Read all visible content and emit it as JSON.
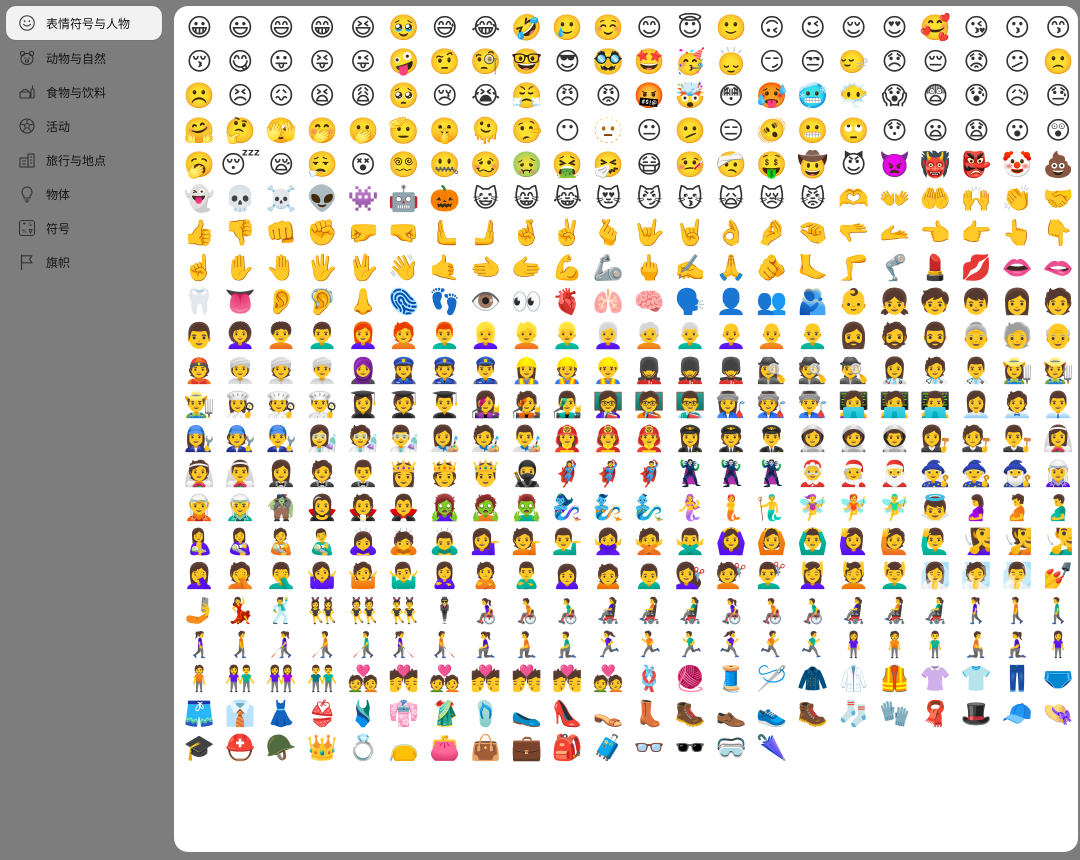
{
  "sidebar": {
    "items": [
      {
        "label": "表情符号与人物",
        "icon": "smiley-icon",
        "active": true
      },
      {
        "label": "动物与自然",
        "icon": "bear-icon",
        "active": false
      },
      {
        "label": "食物与饮料",
        "icon": "food-icon",
        "active": false
      },
      {
        "label": "活动",
        "icon": "ball-icon",
        "active": false
      },
      {
        "label": "旅行与地点",
        "icon": "building-icon",
        "active": false
      },
      {
        "label": "物体",
        "icon": "bulb-icon",
        "active": false
      },
      {
        "label": "符号",
        "icon": "symbols-icon",
        "active": false
      },
      {
        "label": "旗帜",
        "icon": "flag-icon",
        "active": false
      }
    ]
  },
  "emojis": [
    "😀",
    "😃",
    "😄",
    "😁",
    "😆",
    "🥹",
    "😅",
    "😂",
    "🤣",
    "🥲",
    "☺️",
    "😊",
    "😇",
    "🙂",
    "🙃",
    "😉",
    "😌",
    "😍",
    "🥰",
    "😘",
    "😗",
    "😙",
    "😚",
    "😋",
    "😛",
    "😝",
    "😜",
    "🤪",
    "🤨",
    "🧐",
    "🤓",
    "😎",
    "🥸",
    "🤩",
    "🥳",
    "🙂‍↕️",
    "😏",
    "😒",
    "🙂‍↔️",
    "😞",
    "😔",
    "😟",
    "😕",
    "🙁",
    "☹️",
    "😣",
    "😖",
    "😫",
    "😩",
    "🥺",
    "😢",
    "😭",
    "😤",
    "😠",
    "😡",
    "🤬",
    "🤯",
    "😳",
    "🥵",
    "🥶",
    "😶‍🌫️",
    "😱",
    "😨",
    "😰",
    "😥",
    "😓",
    "🤗",
    "🤔",
    "🫣",
    "🤭",
    "🫢",
    "🫡",
    "🤫",
    "🫠",
    "🤥",
    "😶",
    "🫥",
    "😐",
    "🫤",
    "😑",
    "🫨",
    "😬",
    "🙄",
    "😯",
    "😦",
    "😧",
    "😮",
    "😲",
    "🥱",
    "😴",
    "😪",
    "😮‍💨",
    "😵",
    "😵‍💫",
    "🤐",
    "🥴",
    "🤢",
    "🤮",
    "🤧",
    "😷",
    "🤒",
    "🤕",
    "🤑",
    "🤠",
    "😈",
    "👿",
    "👹",
    "👺",
    "🤡",
    "💩",
    "👻",
    "💀",
    "☠️",
    "👽",
    "👾",
    "🤖",
    "🎃",
    "😺",
    "😸",
    "😹",
    "😻",
    "😼",
    "😽",
    "🙀",
    "😿",
    "😾",
    "🫶",
    "👐",
    "🤲",
    "🙌",
    "👏",
    "🤝",
    "👍",
    "👎",
    "👊",
    "✊",
    "🤛",
    "🤜",
    "🫷",
    "🫸",
    "🤞",
    "✌️",
    "🫰",
    "🤟",
    "🤘",
    "👌",
    "🤌",
    "🤏",
    "🫳",
    "🫴",
    "👈",
    "👉",
    "👆",
    "👇",
    "☝️",
    "✋",
    "🤚",
    "🖐️",
    "🖖",
    "👋",
    "🤙",
    "🫲",
    "🫱",
    "💪",
    "🦾",
    "🖕",
    "✍️",
    "🙏",
    "🫵",
    "🦶",
    "🦵",
    "🦿",
    "💄",
    "💋",
    "👄",
    "🫦",
    "🦷",
    "👅",
    "👂",
    "🦻",
    "👃",
    "🫆",
    "👣",
    "👁️",
    "👀",
    "🫀",
    "🫁",
    "🧠",
    "🗣️",
    "👤",
    "👥",
    "🫂",
    "👶",
    "👧",
    "🧒",
    "👦",
    "👩",
    "🧑",
    "👨",
    "👩‍🦱",
    "🧑‍🦱",
    "👨‍🦱",
    "👩‍🦰",
    "🧑‍🦰",
    "👨‍🦰",
    "👱‍♀️",
    "👱",
    "👱‍♂️",
    "👩‍🦳",
    "🧑‍🦳",
    "👨‍🦳",
    "👩‍🦲",
    "🧑‍🦲",
    "👨‍🦲",
    "🧔‍♀️",
    "🧔",
    "🧔‍♂️",
    "👵",
    "🧓",
    "👴",
    "👲",
    "👳‍♀️",
    "👳",
    "👳‍♂️",
    "🧕",
    "👮‍♀️",
    "👮",
    "👮‍♂️",
    "👷‍♀️",
    "👷",
    "👷‍♂️",
    "💂‍♀️",
    "💂",
    "💂‍♂️",
    "🕵️‍♀️",
    "🕵️",
    "🕵️‍♂️",
    "👩‍⚕️",
    "🧑‍⚕️",
    "👨‍⚕️",
    "👩‍🌾",
    "🧑‍🌾",
    "👨‍🌾",
    "👩‍🍳",
    "🧑‍🍳",
    "👨‍🍳",
    "👩‍🎓",
    "🧑‍🎓",
    "👨‍🎓",
    "👩‍🎤",
    "🧑‍🎤",
    "👨‍🎤",
    "👩‍🏫",
    "🧑‍🏫",
    "👨‍🏫",
    "👩‍🏭",
    "🧑‍🏭",
    "👨‍🏭",
    "👩‍💻",
    "🧑‍💻",
    "👨‍💻",
    "👩‍💼",
    "🧑‍💼",
    "👨‍💼",
    "👩‍🔧",
    "🧑‍🔧",
    "👨‍🔧",
    "👩‍🔬",
    "🧑‍🔬",
    "👨‍🔬",
    "👩‍🎨",
    "🧑‍🎨",
    "👨‍🎨",
    "👩‍🚒",
    "🧑‍🚒",
    "👨‍🚒",
    "👩‍✈️",
    "🧑‍✈️",
    "👨‍✈️",
    "👩‍🚀",
    "🧑‍🚀",
    "👨‍🚀",
    "👩‍⚖️",
    "🧑‍⚖️",
    "👨‍⚖️",
    "👰‍♀️",
    "👰",
    "👰‍♂️",
    "🤵‍♀️",
    "🤵",
    "🤵‍♂️",
    "👸",
    "🫅",
    "🤴",
    "🥷",
    "🦸‍♀️",
    "🦸",
    "🦸‍♂️",
    "🦹‍♀️",
    "🦹",
    "🦹‍♂️",
    "🤶",
    "🧑‍🎄",
    "🎅",
    "🧙‍♀️",
    "🧙",
    "🧙‍♂️",
    "🧝‍♀️",
    "🧝",
    "🧝‍♂️",
    "🧌",
    "🧛‍♀️",
    "🧛",
    "🧛‍♂️",
    "🧟‍♀️",
    "🧟",
    "🧟‍♂️",
    "🧞‍♀️",
    "🧞",
    "🧞‍♂️",
    "🧜‍♀️",
    "🧜",
    "🧜‍♂️",
    "🧚‍♀️",
    "🧚",
    "🧚‍♂️",
    "👼",
    "🤰",
    "🫄",
    "🫃",
    "🤱",
    "👩‍🍼",
    "🧑‍🍼",
    "👨‍🍼",
    "🙇‍♀️",
    "🙇",
    "🙇‍♂️",
    "💁‍♀️",
    "💁",
    "💁‍♂️",
    "🙅‍♀️",
    "🙅",
    "🙅‍♂️",
    "🙆‍♀️",
    "🙆",
    "🙆‍♂️",
    "🙋‍♀️",
    "🙋",
    "🙋‍♂️",
    "🧏‍♀️",
    "🧏",
    "🧏‍♂️",
    "🤦‍♀️",
    "🤦",
    "🤦‍♂️",
    "🤷‍♀️",
    "🤷",
    "🤷‍♂️",
    "🙎‍♀️",
    "🙎",
    "🙎‍♂️",
    "🙍‍♀️",
    "🙍",
    "🙍‍♂️",
    "💇‍♀️",
    "💇",
    "💇‍♂️",
    "💆‍♀️",
    "💆",
    "💆‍♂️",
    "🧖‍♀️",
    "🧖",
    "🧖‍♂️",
    "💅",
    "🤳",
    "💃",
    "🕺",
    "👯‍♀️",
    "👯",
    "👯‍♂️",
    "🕴️",
    "👩‍🦽",
    "🧑‍🦽",
    "👨‍🦽",
    "👩‍🦼",
    "🧑‍🦼",
    "👨‍🦼",
    "👩‍🦽",
    "🧑‍🦽",
    "👨‍🦽",
    "👩‍🦼",
    "🧑‍🦼",
    "👨‍🦼",
    "🚶‍♀️",
    "🚶",
    "🚶‍♂️",
    "🚶‍♀️‍➡️",
    "🚶‍➡️",
    "👩‍🦯",
    "🧑‍🦯",
    "👨‍🦯",
    "👩‍🦯‍➡️",
    "🧑‍🦯‍➡️",
    "🧎‍♀️",
    "🧎",
    "🧎‍♂️",
    "🏃‍♀️",
    "🏃",
    "🏃‍♂️",
    "🏃‍♀️‍➡️",
    "🏃‍➡️",
    "🏃‍♂️‍➡️",
    "🧍‍♀️",
    "🧍",
    "🧍‍♂️",
    "🧎‍➡️",
    "🧎‍♀️",
    "🧍‍♀️",
    "🧍",
    "👫",
    "👭",
    "👬",
    "💑",
    "💏",
    "💑",
    "💏",
    "💏",
    "💏",
    "💑",
    "🪢",
    "🧶",
    "🧵",
    "🪡",
    "🧥",
    "🥼",
    "🦺",
    "👚",
    "👕",
    "👖",
    "🩲",
    "🩳",
    "👔",
    "👗",
    "👙",
    "🩱",
    "👘",
    "🥻",
    "🩴",
    "🥿",
    "👠",
    "👡",
    "👢",
    "🥾",
    "👞",
    "👟",
    "🥾",
    "🧦",
    "🧤",
    "🧣",
    "🎩",
    "🧢",
    "👒",
    "🎓",
    "⛑️",
    "🪖",
    "👑",
    "💍",
    "👝",
    "👛",
    "👜",
    "💼",
    "🎒",
    "🧳",
    "👓",
    "🕶️",
    "🥽",
    "🌂"
  ]
}
